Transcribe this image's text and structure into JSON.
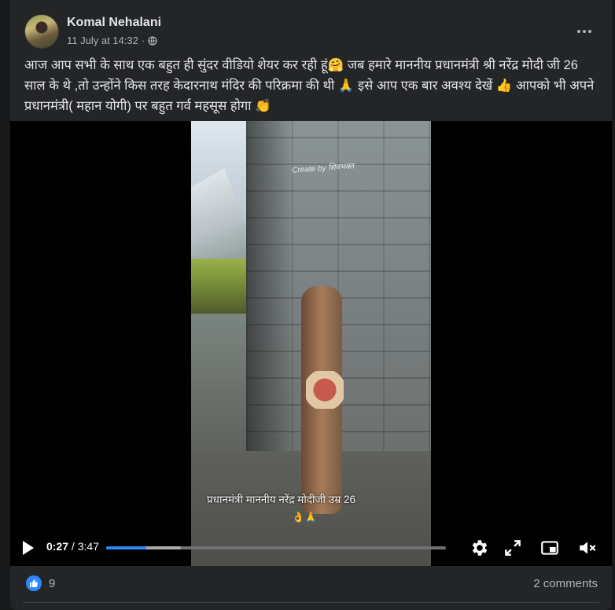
{
  "post": {
    "author": "Komal Nehalani",
    "timestamp": "11 July at 14:32",
    "separator": "·",
    "privacy_icon": "globe-icon",
    "text": "आज आप सभी के साथ एक बहुत ही सुंदर वीडियो शेयर कर रही हूं🤗 जब हमारे माननीय प्रधानमंत्री श्री नरेंद्र मोदी जी 26 साल के थे ,तो उन्होंने किस तरह केदारनाथ मंदिर की परिक्रमा की थी 🙏 इसे आप एक बार अवश्य देखें 👍 आपको भी अपने प्रधानमंत्री( महान योगी) पर बहुत गर्व महसूस होगा 👏"
  },
  "video": {
    "watermark": "Create by शिवभक्त",
    "caption": "प्रधानमंत्री माननीय नरेंद्र मोदीजी उम्र 26",
    "caption_emoji": "👌🙏",
    "current_time": "0:27",
    "duration": "3:47",
    "time_separator": " / ",
    "progress": 0.119,
    "buffered": 0.22,
    "icons": [
      "play-icon",
      "settings-icon",
      "fullscreen-icon",
      "picture-in-picture-icon",
      "mute-icon"
    ]
  },
  "reactions": {
    "like_count": "9",
    "comments": "2 comments"
  },
  "colors": {
    "accent": "#2d88ff",
    "card_bg": "#242526",
    "page_bg": "#18191a"
  }
}
